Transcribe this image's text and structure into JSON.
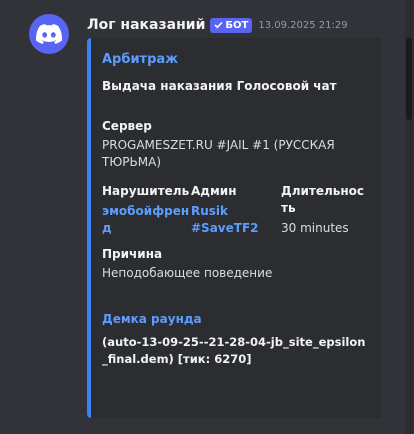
{
  "message": {
    "username": "Лог наказаний",
    "bot_tag": "БОТ",
    "timestamp": "13.09.2025 21:29"
  },
  "embed": {
    "author": "Арбитраж",
    "title": "Выдача наказания Голосовой чат",
    "server_label": "Сервер",
    "server_value": "PROGAMESZET.RU #JAIL #1 (РУССКАЯ ТЮРЬМА)",
    "violator_label": "Нарушитель",
    "violator_value": "эмобойфренд",
    "admin_label": "Админ",
    "admin_value": "Rusik #SaveTF2",
    "duration_label": "Длительность",
    "duration_value": "30 minutes",
    "reason_label": "Причина",
    "reason_value": "Неподобающее поведение",
    "demo_label": "Демка раунда",
    "demo_value": "(auto-13-09-25--21-28-04-jb_site_epsilon_final.dem) [тик: 6270]"
  },
  "colors": {
    "background": "#313338",
    "embed_background": "#2b2d31",
    "embed_accent": "#3b82f6",
    "link": "#5c9dff",
    "blurple": "#5865f2"
  },
  "icons": {
    "avatar": "discord-logo-icon"
  }
}
